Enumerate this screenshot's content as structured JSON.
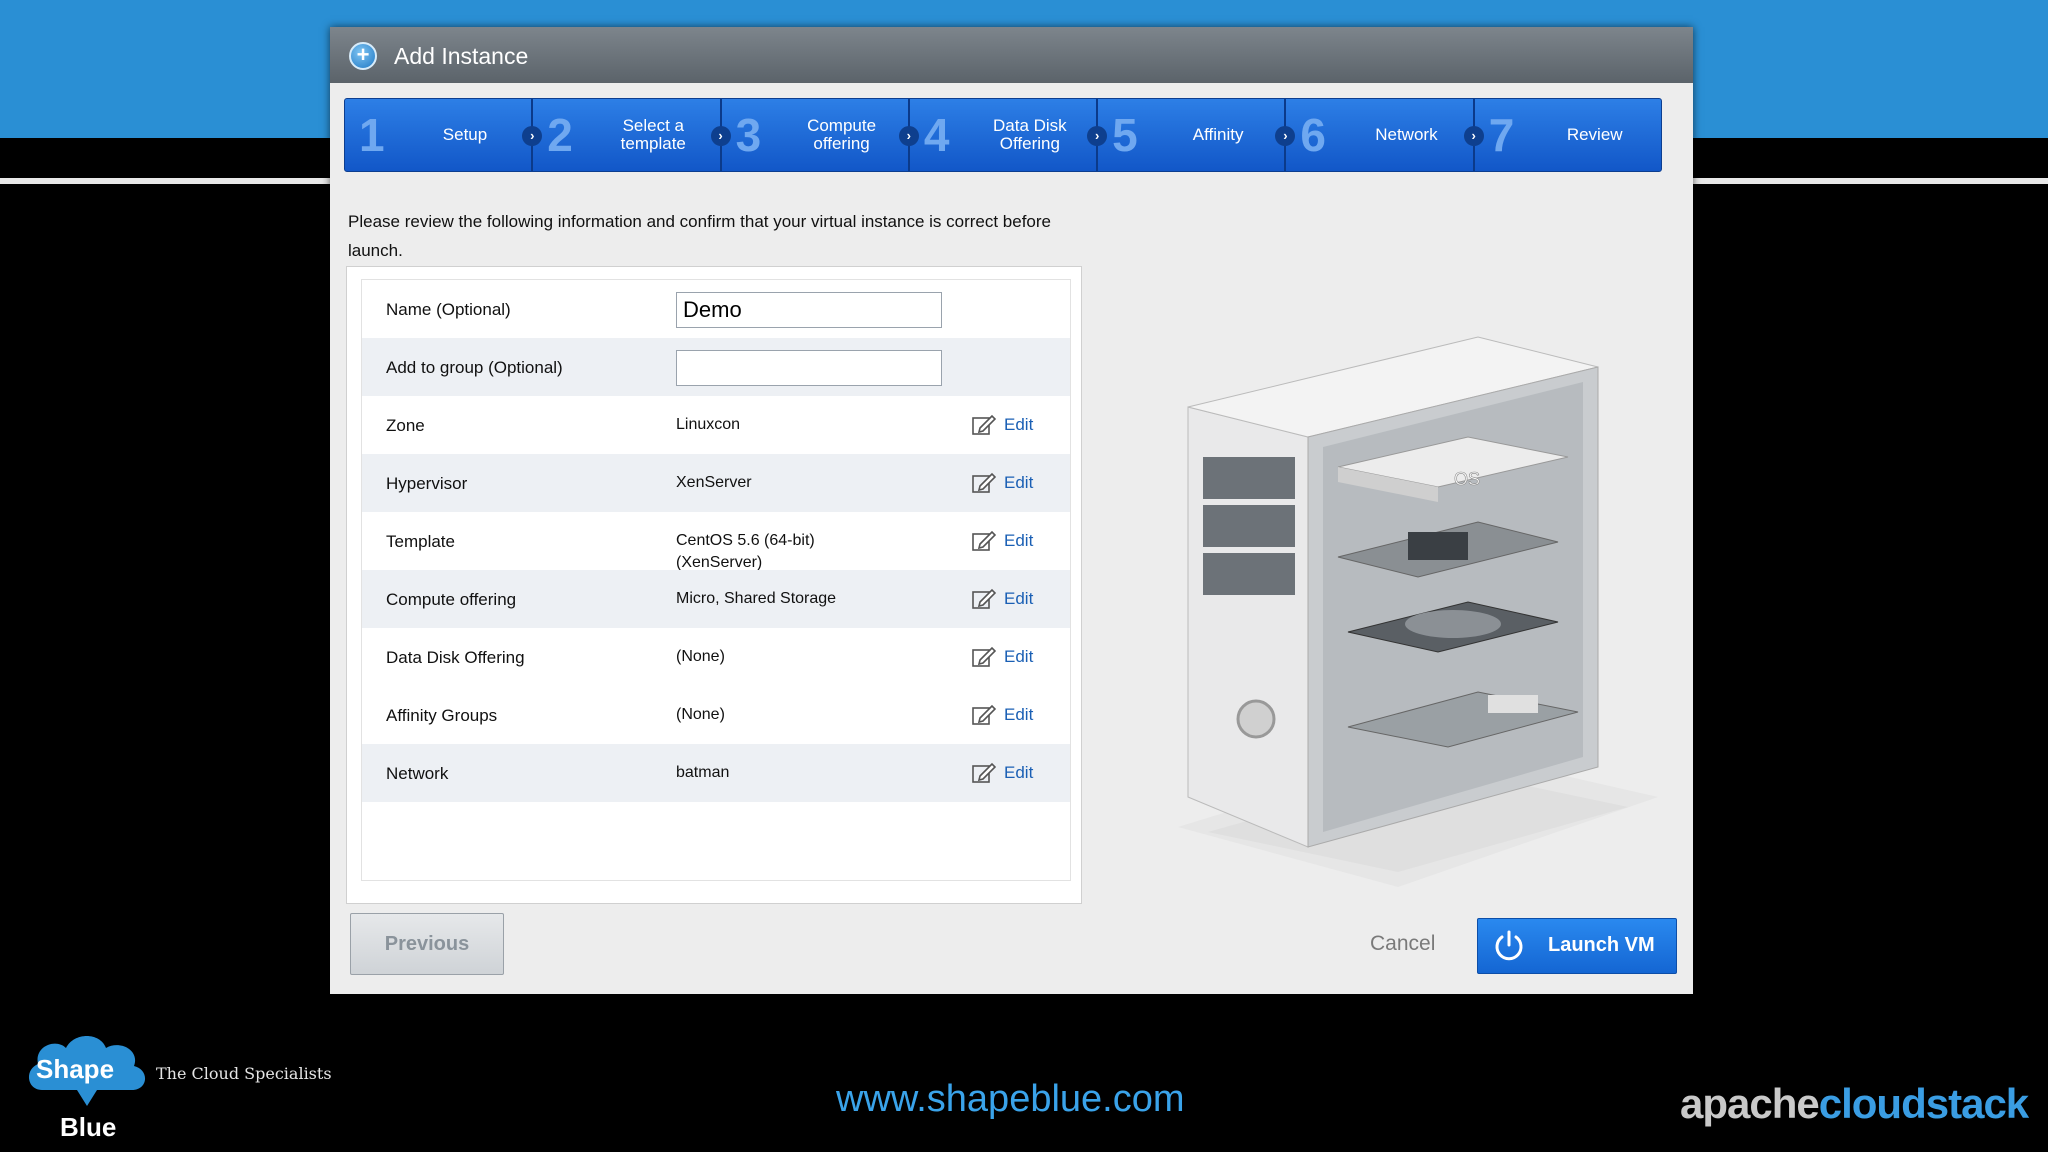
{
  "dialog": {
    "title": "Add Instance"
  },
  "steps": [
    {
      "num": "1",
      "label": "Setup"
    },
    {
      "num": "2",
      "label": "Select a template"
    },
    {
      "num": "3",
      "label": "Compute offering"
    },
    {
      "num": "4",
      "label": "Data Disk Offering"
    },
    {
      "num": "5",
      "label": "Affinity"
    },
    {
      "num": "6",
      "label": "Network"
    },
    {
      "num": "7",
      "label": "Review"
    }
  ],
  "intro": "Please review the following information and confirm that your virtual instance is correct before launch.",
  "review": {
    "name": {
      "label": "Name (Optional)",
      "value": "Demo"
    },
    "group": {
      "label": "Add to group (Optional)",
      "value": ""
    },
    "rows": [
      {
        "label": "Zone",
        "value": "Linuxcon",
        "edit": "Edit"
      },
      {
        "label": "Hypervisor",
        "value": "XenServer",
        "edit": "Edit"
      },
      {
        "label": "Template",
        "value": "CentOS 5.6 (64-bit) (XenServer)",
        "edit": "Edit"
      },
      {
        "label": "Compute offering",
        "value": "Micro, Shared Storage",
        "edit": "Edit"
      },
      {
        "label": "Data Disk Offering",
        "value": "(None)",
        "edit": "Edit"
      },
      {
        "label": "Affinity Groups",
        "value": "(None)",
        "edit": "Edit"
      },
      {
        "label": "Network",
        "value": "batman",
        "edit": "Edit"
      }
    ]
  },
  "illustration": {
    "os_label": "OS"
  },
  "buttons": {
    "previous": "Previous",
    "cancel": "Cancel",
    "launch": "Launch VM"
  },
  "footer": {
    "logo_top": "Shape",
    "logo_bottom": "Blue",
    "tagline": "The Cloud Specialists",
    "url": "www.shapeblue.com",
    "brand_part1": "apache",
    "brand_part2": "cloudstack"
  },
  "colors": {
    "accent": "#2a8fd4",
    "step_blue": "#1a6ad8",
    "link": "#1a5fb4"
  }
}
